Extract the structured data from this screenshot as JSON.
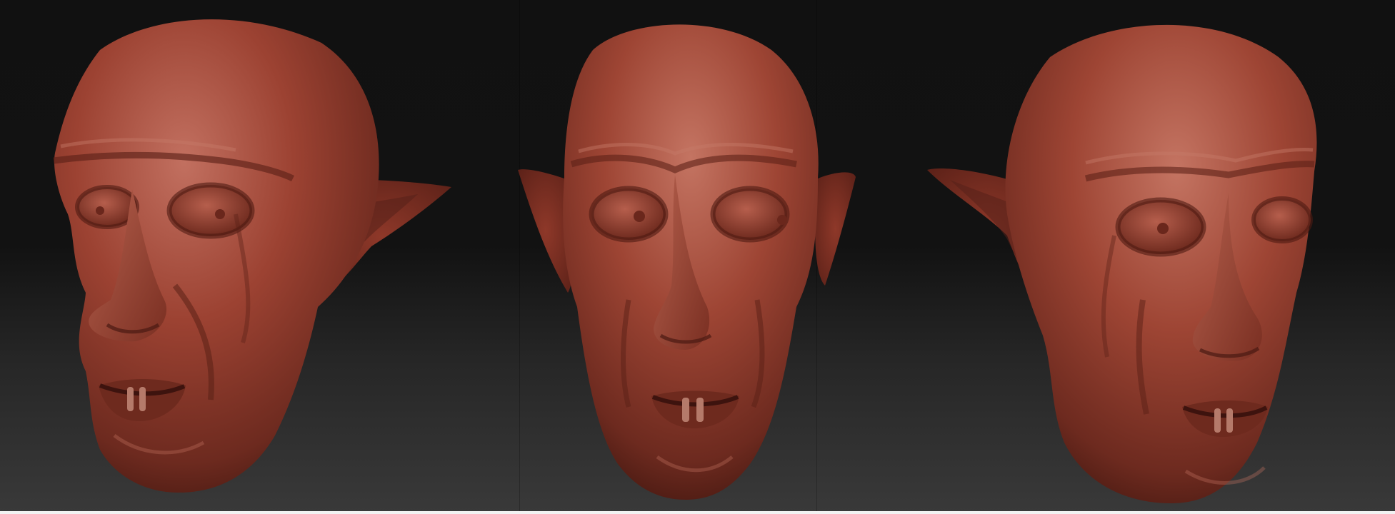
{
  "scene": {
    "subject": "vampire-head-sculpt",
    "views": [
      {
        "id": "three-quarter-left",
        "facing": "left"
      },
      {
        "id": "front",
        "facing": "front"
      },
      {
        "id": "three-quarter-right",
        "facing": "right"
      }
    ],
    "colors": {
      "background_top": "#111111",
      "background_bottom": "#393939",
      "clay_base": "#9a3e2f",
      "clay_highlight": "#c06a57",
      "clay_shadow": "#5a1f16",
      "clay_deep": "#3d130e",
      "tooth": "#b57a6a"
    }
  }
}
